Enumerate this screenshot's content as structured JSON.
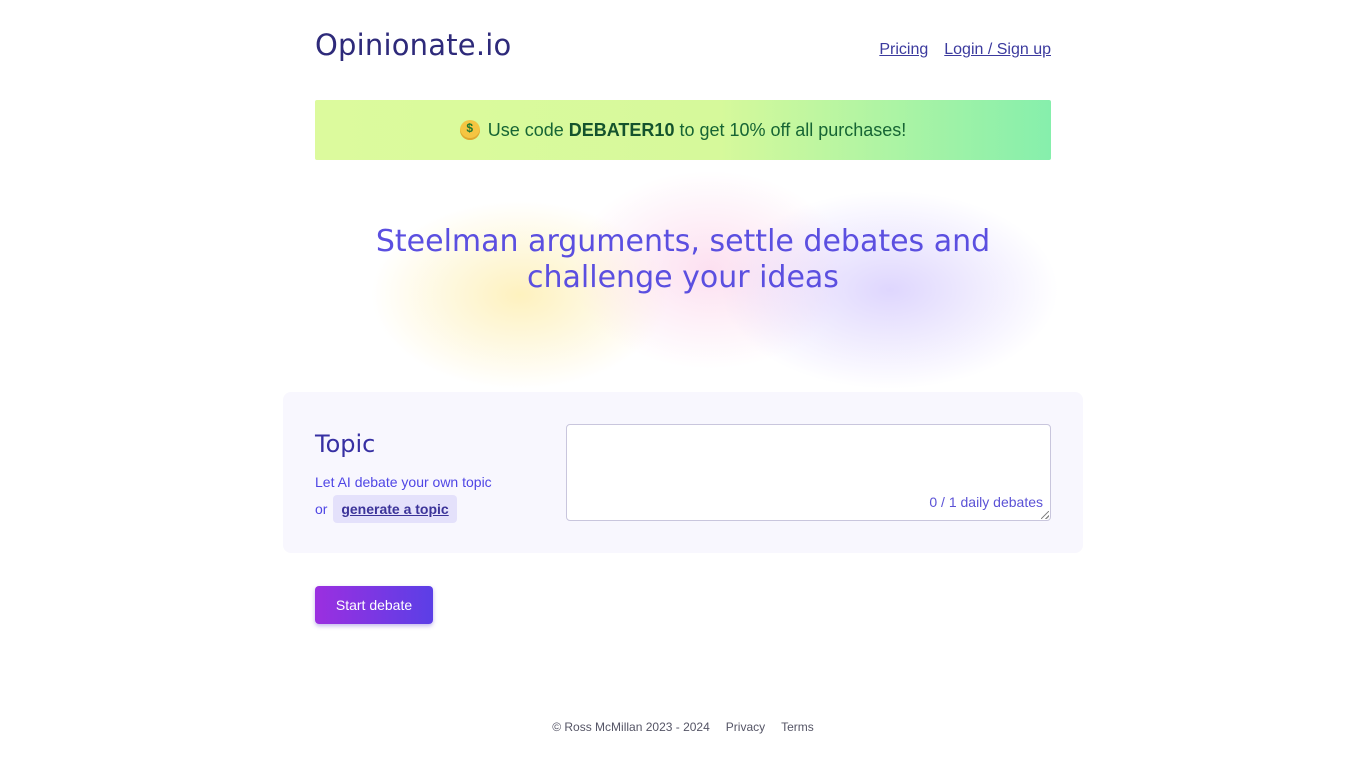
{
  "header": {
    "logo": "Opinionate.io",
    "nav": {
      "pricing": "Pricing",
      "login": "Login / Sign up"
    }
  },
  "promo": {
    "icon": "money-mouth-face-icon",
    "prefix": "Use code",
    "code": "DEBATER10",
    "suffix": "to get 10% off all purchases!"
  },
  "hero": {
    "title": "Steelman arguments, settle debates and challenge your ideas"
  },
  "topic": {
    "heading": "Topic",
    "description": "Let AI debate your own topic",
    "or": "or",
    "generate_link": "generate a topic",
    "input_value": "",
    "counter": "0 / 1 daily debates"
  },
  "actions": {
    "start_button": "Start debate"
  },
  "footer": {
    "copyright": "© Ross McMillan 2023 - 2024",
    "privacy": "Privacy",
    "terms": "Terms"
  },
  "colors": {
    "brand": "#2e2a7a",
    "accent": "#5b4fe0",
    "promo_text": "#166534",
    "button_start": "#9b2fe0",
    "button_end": "#5b3fe6"
  }
}
